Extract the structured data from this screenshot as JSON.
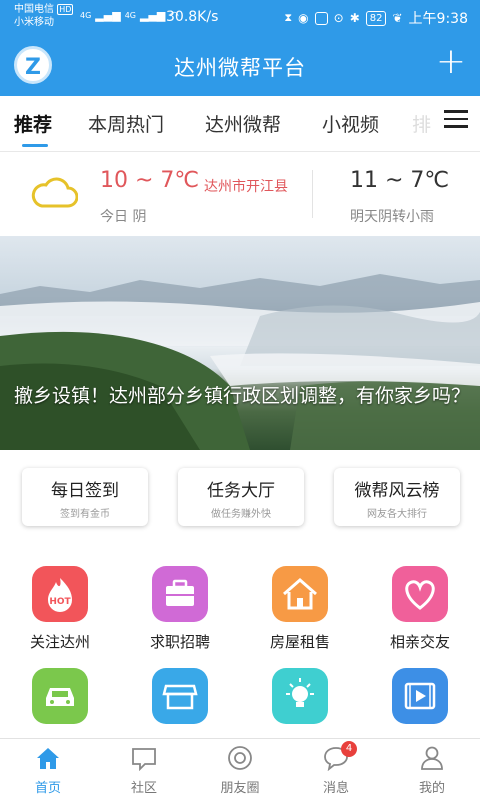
{
  "status_bar": {
    "carrier1": "中国电信",
    "carrier2": "小米移动",
    "hd": "HD",
    "net1": "4G",
    "net2": "4G",
    "speed": "30.8K/s",
    "battery": "82",
    "time": "上午9:38"
  },
  "app_bar": {
    "logo_letter": "Z",
    "title": "达州微帮平台",
    "add_symbol": "+"
  },
  "tabs": {
    "items": [
      "推荐",
      "本周热门",
      "达州微帮",
      "小视频"
    ],
    "overflow": "排",
    "active_index": 0
  },
  "weather": {
    "today_temp": "10 ~ 7℃",
    "location": "达州市开江县",
    "today_label": "今日 阴",
    "tomorrow_temp": "11 ~ 7℃",
    "tomorrow_label": "明天阴转小雨"
  },
  "banner": {
    "caption": "撤乡设镇！达州部分乡镇行政区划调整，有你家乡吗？"
  },
  "actions": [
    {
      "label": "每日签到",
      "sub": "签到有金币"
    },
    {
      "label": "任务大厅",
      "sub": "做任务赚外快"
    },
    {
      "label": "微帮风云榜",
      "sub": "网友各大排行"
    }
  ],
  "grid": {
    "items": [
      {
        "label": "关注达州",
        "icon": "hot-icon",
        "color": "#f2555a"
      },
      {
        "label": "求职招聘",
        "icon": "briefcase-icon",
        "color": "#d06ad6"
      },
      {
        "label": "房屋租售",
        "icon": "house-icon",
        "color": "#f79a45"
      },
      {
        "label": "相亲交友",
        "icon": "heart-icon",
        "color": "#f0609a"
      },
      {
        "label": "",
        "icon": "car-icon",
        "color": "#7bc84c"
      },
      {
        "label": "",
        "icon": "store-icon",
        "color": "#39a8e8"
      },
      {
        "label": "",
        "icon": "lightbulb-icon",
        "color": "#3fcfd0"
      },
      {
        "label": "",
        "icon": "video-icon",
        "color": "#3d8fe6"
      }
    ]
  },
  "bottom_nav": {
    "items": [
      "首页",
      "社区",
      "朋友圈",
      "消息",
      "我的"
    ],
    "message_badge": "4",
    "active_color": "#2f9ae8"
  }
}
